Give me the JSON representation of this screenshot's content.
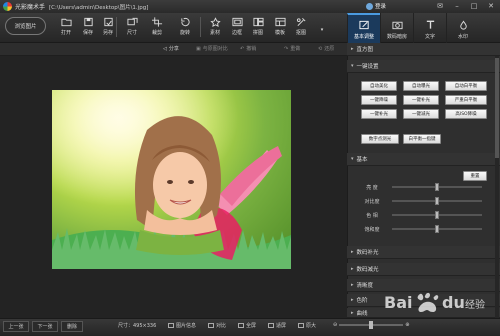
{
  "titlebar": {
    "app_name": "光影魔术手",
    "path": "[C:\\Users\\admin\\Desktop\\图片\\1.jpg]",
    "login_label": "登录"
  },
  "toolbar": {
    "browse_label": "浏览图片",
    "items": [
      {
        "label": "打开",
        "icon": "folder-open-icon"
      },
      {
        "label": "保存",
        "icon": "save-icon"
      },
      {
        "label": "另存",
        "icon": "save-as-icon"
      },
      {
        "label": "尺寸",
        "icon": "resize-icon"
      },
      {
        "label": "裁剪",
        "icon": "crop-icon"
      },
      {
        "label": "旋转",
        "icon": "rotate-icon"
      },
      {
        "label": "素材",
        "icon": "material-icon"
      },
      {
        "label": "边框",
        "icon": "border-icon"
      },
      {
        "label": "拼图",
        "icon": "collage-icon"
      },
      {
        "label": "模板",
        "icon": "template-icon"
      },
      {
        "label": "抠图",
        "icon": "cutout-icon"
      }
    ],
    "tabs": [
      {
        "label": "基本调整",
        "icon": "adjust-icon",
        "active": true
      },
      {
        "label": "数码暗房",
        "icon": "darkroom-icon",
        "active": false
      },
      {
        "label": "文字",
        "icon": "text-icon",
        "active": false
      },
      {
        "label": "水印",
        "icon": "watermark-icon",
        "active": false
      }
    ]
  },
  "subtoolbar": {
    "share": "分享",
    "original": "与原图对比",
    "undo": "撤销",
    "redo": "重做",
    "restore": "还原"
  },
  "panel": {
    "histogram": "直方图",
    "one_click": "一键设置",
    "one_click_buttons": [
      "自动美化",
      "自动曝光",
      "自动白平衡",
      "一键降噪",
      "一键补光",
      "严重白平衡",
      "一键补光",
      "一键减光",
      "高ISO降噪",
      "数字点测光",
      "白平衡一指键"
    ],
    "basic": "基本",
    "reset": "重置",
    "sliders": [
      {
        "label": "亮 度",
        "value": 0.5
      },
      {
        "label": "对比度",
        "value": 0.5
      },
      {
        "label": "色 相",
        "value": 0.5
      },
      {
        "label": "饱和度",
        "value": 0.5
      }
    ],
    "sections": [
      "数码补光",
      "数码减光",
      "清晰度",
      "色阶",
      "曲线"
    ]
  },
  "statusbar": {
    "prev": "上一张",
    "next": "下一张",
    "delete": "删除",
    "size_info": "尺寸：495×336",
    "photo_info": "图片信息",
    "compare": "对比",
    "fullscreen": "全屏",
    "fit": "适屏",
    "original_size": "原大",
    "zoom_value": 0.5
  },
  "watermark": {
    "text": "Baidu 经验"
  }
}
